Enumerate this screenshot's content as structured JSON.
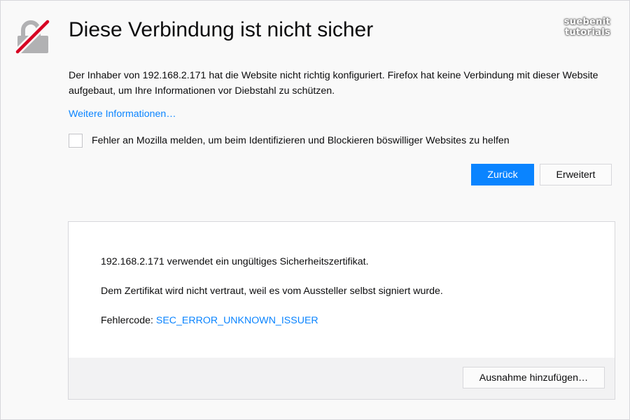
{
  "watermark": {
    "line1": "suebenit",
    "line2": "tutorials"
  },
  "lock_icon": "broken-lock-icon",
  "title": "Diese Verbindung ist nicht sicher",
  "intro": "Der Inhaber von 192.168.2.171 hat die Website nicht richtig konfiguriert. Firefox hat keine Verbindung mit dieser Website aufgebaut, um Ihre Informationen vor Diebstahl zu schützen.",
  "more_info_link": "Weitere Informationen…",
  "report": {
    "checked": false,
    "label": "Fehler an Mozilla melden, um beim Identifizieren und Blockieren böswilliger Websites zu helfen"
  },
  "buttons": {
    "back": "Zurück",
    "advanced": "Erweitert"
  },
  "details": {
    "line1": "192.168.2.171 verwendet ein ungültiges Sicherheitszertifikat.",
    "line2": "Dem Zertifikat wird nicht vertraut, weil es vom Aussteller selbst signiert wurde.",
    "error_code_label": "Fehlercode: ",
    "error_code": "SEC_ERROR_UNKNOWN_ISSUER",
    "add_exception_button": "Ausnahme hinzufügen…"
  },
  "colors": {
    "accent": "#0a84ff",
    "lock_grey": "#b1b1b3",
    "lock_strike": "#d70022",
    "background": "#f9f9f9"
  }
}
